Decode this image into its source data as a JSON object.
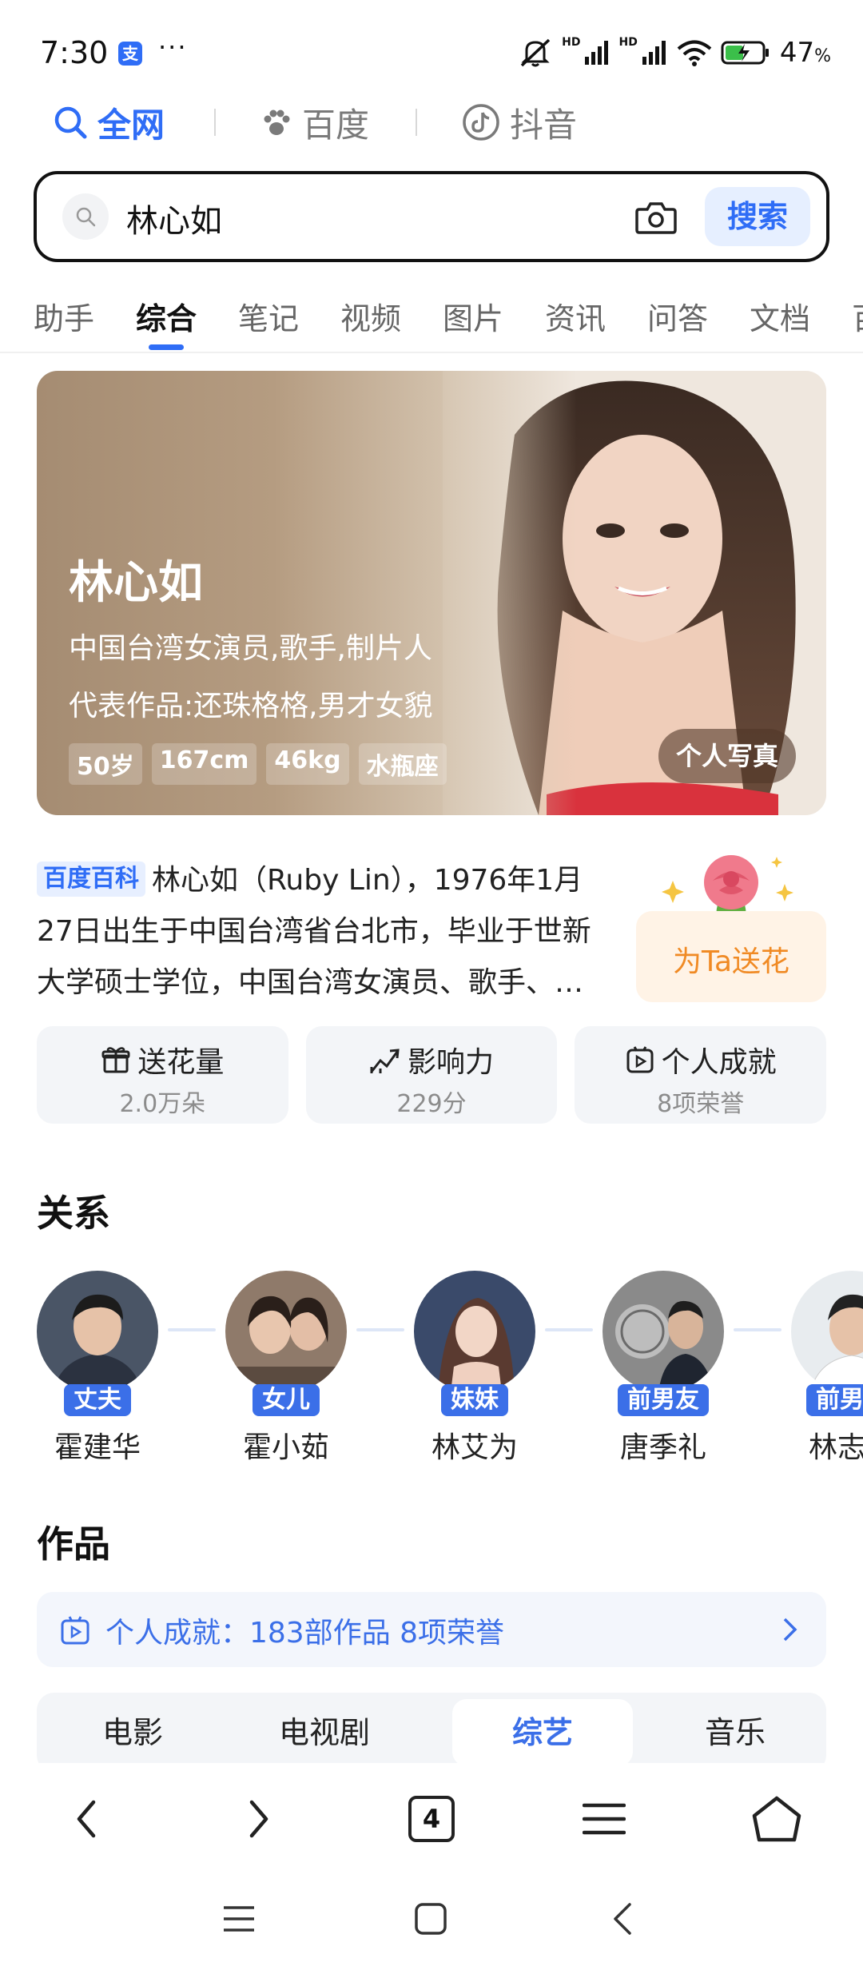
{
  "status_bar": {
    "time": "7:30",
    "app_badge": "支",
    "more": "···",
    "hd1": "HD",
    "hd2": "HD",
    "battery": "47",
    "battery_unit": "%"
  },
  "scope_tabs": [
    {
      "label": "全网",
      "icon": "search-icon",
      "active": true
    },
    {
      "label": "百度",
      "icon": "paw-icon",
      "active": false
    },
    {
      "label": "抖音",
      "icon": "tiktok-icon",
      "active": false
    }
  ],
  "search": {
    "query": "林心如",
    "button_label": "搜索"
  },
  "category_tabs": [
    "助手",
    "综合",
    "笔记",
    "视频",
    "图片",
    "资讯",
    "问答",
    "文档",
    "百"
  ],
  "hero": {
    "name": "林心如",
    "description": "中国台湾女演员,歌手,制片人",
    "works": "代表作品:还珠格格,男才女貌",
    "tags": [
      "50岁",
      "167cm",
      "46kg",
      "水瓶座"
    ],
    "photo_button": "个人写真"
  },
  "intro": {
    "badge": "百度百科",
    "text": "林心如（Ruby Lin），1976年1月27日出生于中国台湾省台北市，毕业于世新大学硕士学位，中国台湾女演员、歌手、制片人…"
  },
  "flower_button": "为Ta送花",
  "stats": [
    {
      "title": "送花量",
      "value": "2.0万朵",
      "icon": "gift-icon"
    },
    {
      "title": "影响力",
      "value": "229分",
      "icon": "trend-icon"
    },
    {
      "title": "个人成就",
      "value": "8项荣誉",
      "icon": "play-badge-icon"
    }
  ],
  "relations_title": "关系",
  "relations": [
    {
      "role": "丈夫",
      "name": "霍建华"
    },
    {
      "role": "女儿",
      "name": "霍小茹"
    },
    {
      "role": "妹妹",
      "name": "林艾为"
    },
    {
      "role": "前男友",
      "name": "唐季礼"
    },
    {
      "role": "前男友",
      "name": "林志颖"
    }
  ],
  "works_title": "作品",
  "achievement_bar": "个人成就：183部作品 8项荣誉",
  "works_tabs": [
    {
      "label": "电影",
      "active": false
    },
    {
      "label": "电视剧",
      "active": false
    },
    {
      "label": "综艺",
      "active": true
    },
    {
      "label": "音乐",
      "active": false
    }
  ],
  "browser_bar": {
    "tab_count": "4"
  },
  "colors": {
    "accent": "#2f6df6",
    "relation_badge": "#3b6fe8",
    "flower": "#f08a24"
  }
}
